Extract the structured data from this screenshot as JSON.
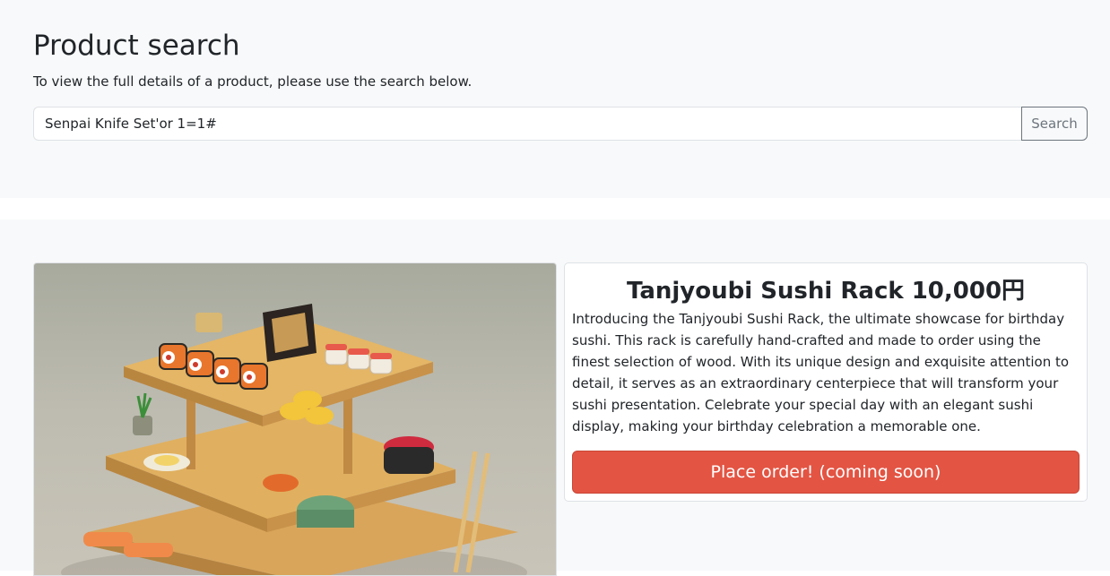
{
  "search": {
    "title": "Product search",
    "subtitle": "To view the full details of a product, please use the search below.",
    "input_value": "Senpai Knife Set'or 1=1#",
    "button_label": "Search"
  },
  "product": {
    "image_alt": "sushi-rack-photo",
    "title": "Tanjyoubi Sushi Rack 10,000円",
    "description": "Introducing the Tanjyoubi Sushi Rack, the ultimate showcase for birthday sushi. This rack is carefully hand-crafted and made to order using the finest selection of wood. With its unique design and exquisite attention to detail, it serves as an extraordinary centerpiece that will transform your sushi presentation. Celebrate your special day with an elegant sushi display, making your birthday celebration a memorable one.",
    "order_button_label": "Place order! (coming soon)"
  },
  "colors": {
    "background": "#f8f9fa",
    "order_button": "#e35443",
    "search_button": "#6c757d"
  }
}
